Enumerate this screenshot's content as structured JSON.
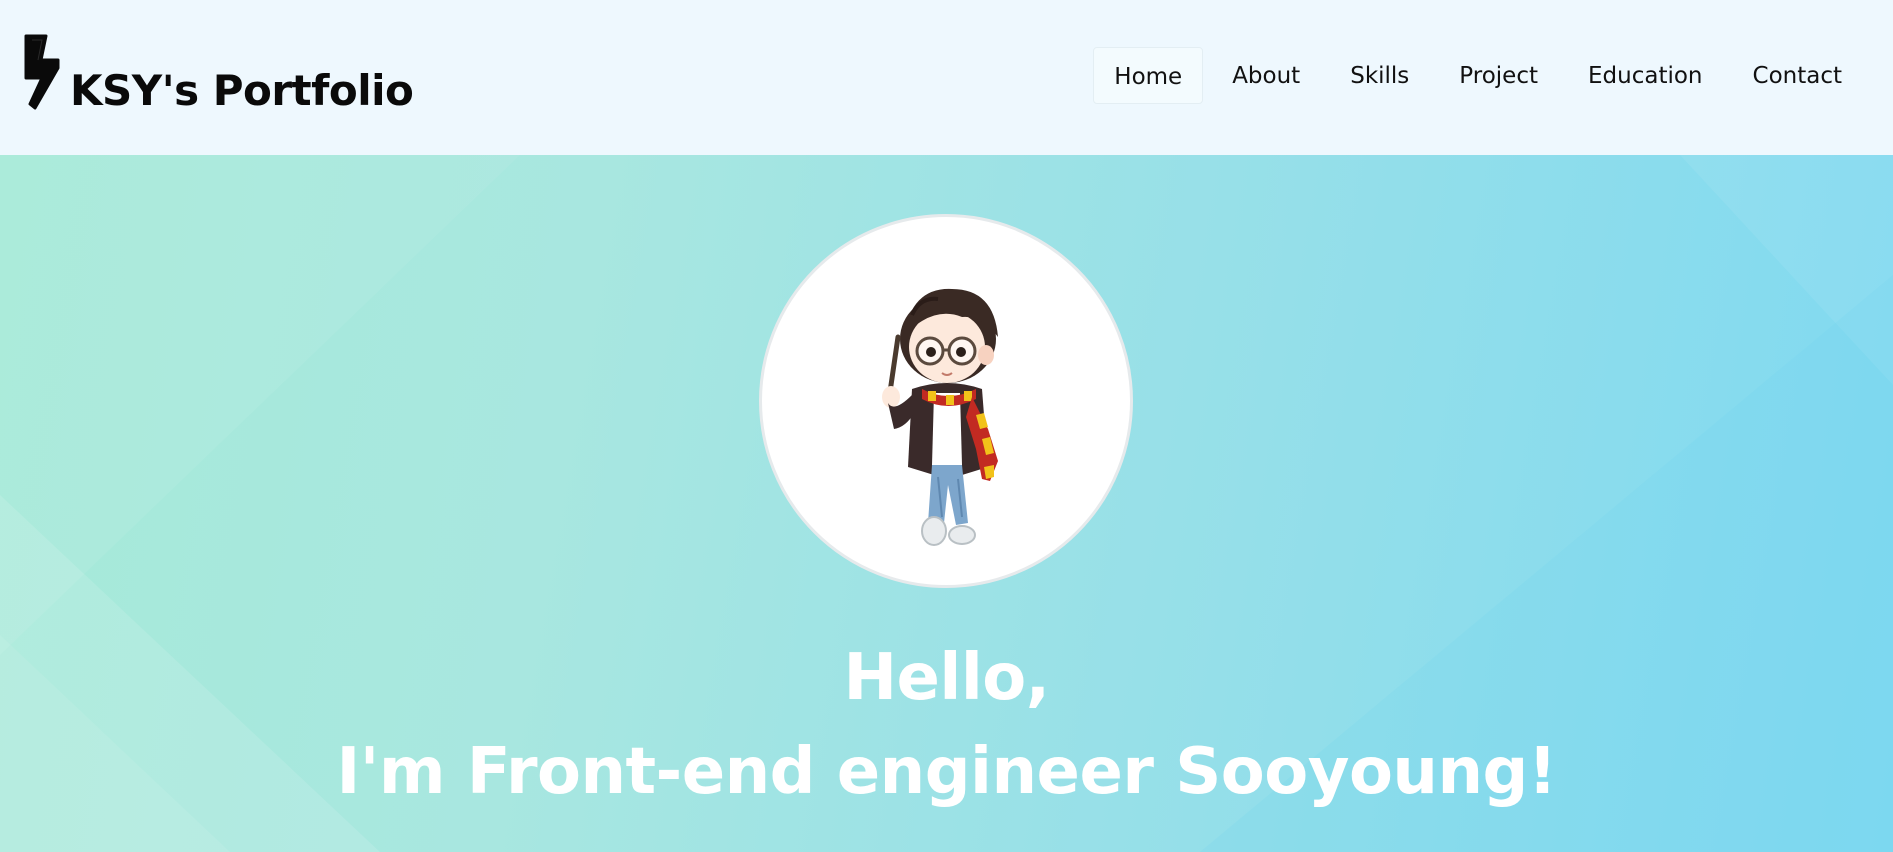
{
  "brand": {
    "title": "KSY's Portfolio",
    "icon": "lightning-bolt-icon"
  },
  "nav": {
    "items": [
      {
        "label": "Home",
        "active": true
      },
      {
        "label": "About",
        "active": false
      },
      {
        "label": "Skills",
        "active": false
      },
      {
        "label": "Project",
        "active": false
      },
      {
        "label": "Education",
        "active": false
      },
      {
        "label": "Contact",
        "active": false
      }
    ]
  },
  "hero": {
    "avatar": "profile-avatar-illustration",
    "heading_line1": "Hello,",
    "heading_line2": "I'm Front-end engineer Sooyoung!"
  },
  "colors": {
    "navbar_bg": "#eef8fe",
    "hero_gradient_start": "#a6ead8",
    "hero_gradient_end": "#7fd9f1",
    "heading_text": "#ffffff",
    "brand_text": "#0a0a0a"
  }
}
